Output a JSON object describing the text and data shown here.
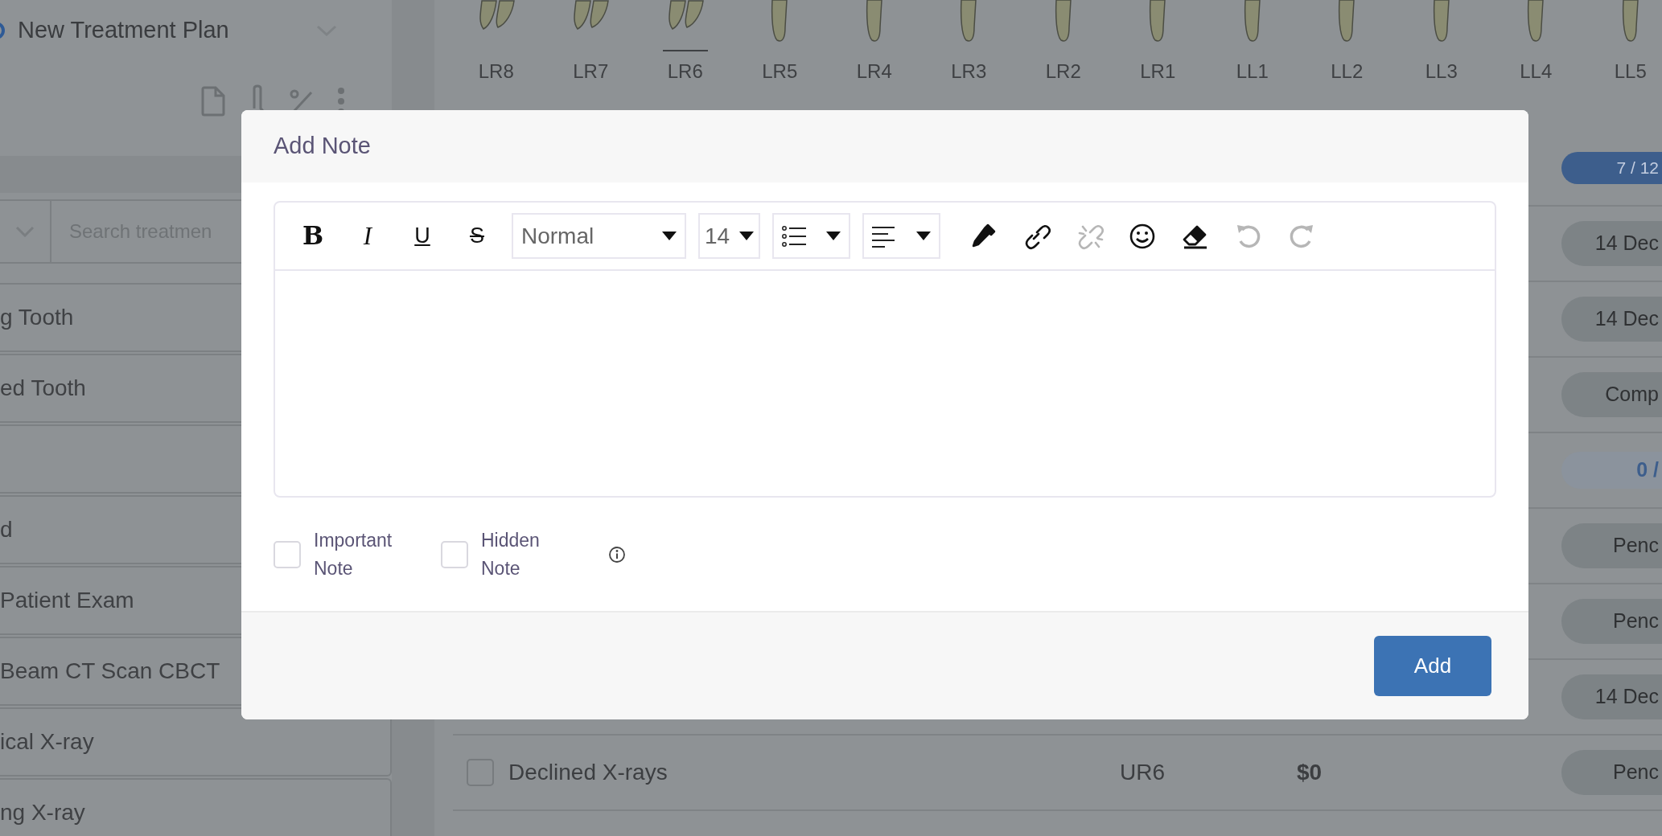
{
  "left_panel": {
    "plan_selector": {
      "label": "New Treatment Plan",
      "selected": true
    },
    "search": {
      "placeholder": "Search treatmen"
    },
    "treatments": [
      {
        "label": "g Tooth"
      },
      {
        "label": "ed Tooth"
      },
      {
        "kind": "blank"
      },
      {
        "label": "d"
      },
      {
        "label": "Patient Exam"
      },
      {
        "label": "Beam CT Scan CBCT"
      },
      {
        "label": "ical X-ray"
      },
      {
        "label": "ng X-ray"
      }
    ]
  },
  "tooth_chart": {
    "teeth": [
      {
        "label": "LR8",
        "kind": "molar",
        "selected": false
      },
      {
        "label": "LR7",
        "kind": "molar",
        "selected": false
      },
      {
        "label": "LR6",
        "kind": "molar",
        "selected": true
      },
      {
        "label": "LR5",
        "kind": "single",
        "selected": false
      },
      {
        "label": "LR4",
        "kind": "single",
        "selected": false
      },
      {
        "label": "LR3",
        "kind": "single",
        "selected": false
      },
      {
        "label": "LR2",
        "kind": "single",
        "selected": false
      },
      {
        "label": "LR1",
        "kind": "single",
        "selected": false
      },
      {
        "label": "LL1",
        "kind": "single",
        "selected": false
      },
      {
        "label": "LL2",
        "kind": "single",
        "selected": false
      },
      {
        "label": "LL3",
        "kind": "single",
        "selected": false
      },
      {
        "label": "LL4",
        "kind": "single",
        "selected": false
      },
      {
        "label": "LL5",
        "kind": "single",
        "selected": false
      }
    ]
  },
  "treatment_rows": [
    {
      "badge": "7 / 12",
      "kind": "progress"
    },
    {
      "badge": "14 Dec",
      "kind": "status"
    },
    {
      "badge": "14 Dec",
      "kind": "status"
    },
    {
      "badge": "Comp",
      "kind": "status"
    },
    {
      "badge": "0 /",
      "kind": "count"
    },
    {
      "badge": "Penc",
      "kind": "status"
    },
    {
      "badge": "Penc",
      "kind": "status"
    },
    {
      "badge": "14 Dec",
      "kind": "status"
    },
    {
      "badge": "Penc",
      "kind": "status",
      "name": "Declined X-rays",
      "tooth": "UR6",
      "fee": "$0",
      "checked": false
    }
  ],
  "modal": {
    "title": "Add Note",
    "toolbar": [
      {
        "kind": "bold",
        "label": "B",
        "disabled": false
      },
      {
        "kind": "italic",
        "label": "I",
        "disabled": false
      },
      {
        "kind": "underline",
        "label": "U",
        "disabled": false
      },
      {
        "kind": "strike",
        "label": "S",
        "disabled": false
      },
      {
        "kind": "select",
        "label": "Normal",
        "disabled": false
      },
      {
        "kind": "size",
        "label": "14",
        "disabled": false
      },
      {
        "kind": "list",
        "disabled": false
      },
      {
        "kind": "align",
        "disabled": false
      },
      {
        "kind": "color",
        "disabled": false
      },
      {
        "kind": "link",
        "disabled": false
      },
      {
        "kind": "unlink",
        "disabled": true
      },
      {
        "kind": "emoji",
        "disabled": false
      },
      {
        "kind": "clear",
        "disabled": false
      },
      {
        "kind": "undo",
        "disabled": true
      },
      {
        "kind": "redo",
        "disabled": true
      }
    ],
    "options": [
      {
        "label": "Important Note",
        "checked": false
      },
      {
        "label": "Hidden Note",
        "checked": false
      }
    ],
    "button": "Add"
  }
}
